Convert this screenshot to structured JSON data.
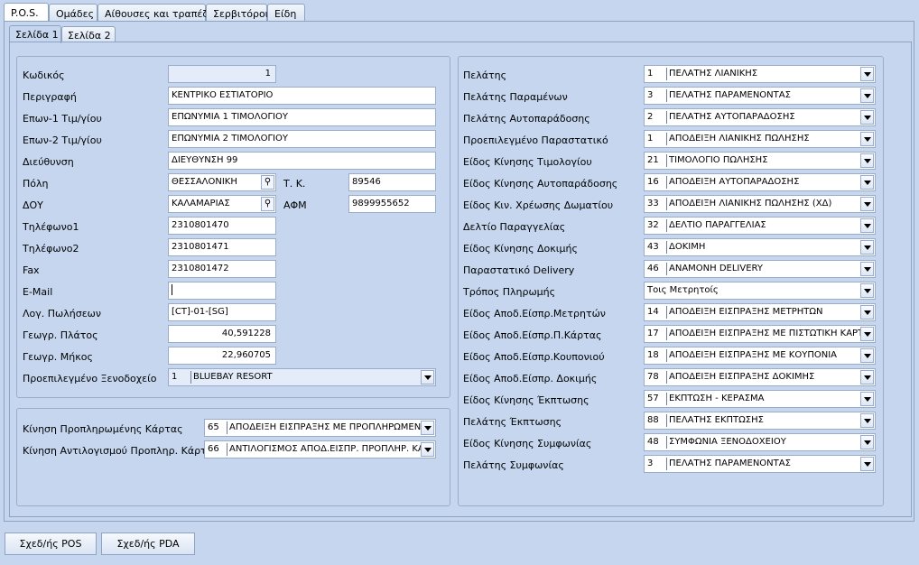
{
  "tabs": [
    "P.O.S.",
    "Ομάδες",
    "Αίθουσες και τραπέζια",
    "Σερβιτόροι",
    "Είδη"
  ],
  "subtabs": [
    "Σελίδα 1",
    "Σελίδα 2"
  ],
  "left": {
    "kodikos": {
      "label": "Κωδικός",
      "value": "1"
    },
    "perigrafi": {
      "label": "Περιγραφή",
      "value": "ΚΕΝΤΡΙΚΟ ΕΣΤΙΑΤΟΡΙΟ"
    },
    "eponymia1": {
      "label": "Επων-1 Τιμ/γίου",
      "value": "ΕΠΩΝΥΜΙΑ 1 ΤΙΜΟΛΟΓΙΟΥ"
    },
    "eponymia2": {
      "label": "Επων-2 Τιμ/γίου",
      "value": "ΕΠΩΝΥΜΙΑ 2 ΤΙΜΟΛΟΓΙΟΥ"
    },
    "dieythynsi": {
      "label": "Διεύθυνση",
      "value": "ΔΙΕΥΘΥΝΣΗ 99"
    },
    "poli": {
      "label": "Πόλη",
      "value": "ΘΕΣΣΑΛΟΝΙΚΗ"
    },
    "tk": {
      "label": "Τ. Κ.",
      "value": "89546"
    },
    "doy": {
      "label": "ΔΟΥ",
      "value": "ΚΑΛΑΜΑΡΙΑΣ"
    },
    "afm": {
      "label": "ΑΦΜ",
      "value": "9899955652"
    },
    "tel1": {
      "label": "Τηλέφωνο1",
      "value": "2310801470"
    },
    "tel2": {
      "label": "Τηλέφωνο2",
      "value": "2310801471"
    },
    "fax": {
      "label": "Fax",
      "value": "2310801472"
    },
    "email": {
      "label": "E-Mail",
      "value": ""
    },
    "log_poliseon": {
      "label": "Λογ. Πωλήσεων",
      "value": "[CT]-01-[SG]"
    },
    "platos": {
      "label": "Γεωγρ. Πλάτος",
      "value": "40,591228"
    },
    "mikos": {
      "label": "Γεωγρ. Μήκος",
      "value": "22,960705"
    },
    "xenodoxeio": {
      "label": "Προεπιλεγμένο Ξενοδοχείο",
      "code": "1",
      "text": "BLUEBAY RESORT"
    }
  },
  "bottom_left": {
    "kinisi_prepaid": {
      "label": "Κίνηση Προπληρωμένης Κάρτας",
      "code": "65",
      "text": "ΑΠΟΔΕΙΞΗ ΕΙΣΠΡΑΞΗΣ ΜΕ ΠΡΟΠΛΗΡΩΜΕΝΗ"
    },
    "kinisi_antilog": {
      "label": "Κίνηση Αντιλογισμού Προπληρ. Κάρτας",
      "code": "66",
      "text": "ΑΝΤΙΛΟΓΙΣΜΟΣ ΑΠΟΔ.ΕΙΣΠΡ. ΠΡΟΠΛΗΡ. ΚΑ"
    }
  },
  "right": [
    {
      "label": "Πελάτης",
      "code": "1",
      "text": "ΠΕΛΑΤΗΣ ΛΙΑΝΙΚΗΣ"
    },
    {
      "label": "Πελάτης Παραμένων",
      "code": "3",
      "text": "ΠΕΛΑΤΗΣ ΠΑΡΑΜΕΝΟΝΤΑΣ"
    },
    {
      "label": "Πελάτης Αυτοπαράδοσης",
      "code": "2",
      "text": "ΠΕΛΑΤΗΣ ΑΥΤΟΠΑΡΑΔΟΣΗΣ"
    },
    {
      "label": "Προεπιλεγμένο Παραστατικό",
      "code": "1",
      "text": "ΑΠΟΔΕΙΞΗ ΛΙΑΝΙΚΗΣ ΠΩΛΗΣΗΣ"
    },
    {
      "label": "Είδος Κίνησης Τιμολογίου",
      "code": "21",
      "text": "ΤΙΜΟΛΟΓΙΟ ΠΩΛΗΣΗΣ"
    },
    {
      "label": "Είδος Κίνησης Αυτοπαράδοσης",
      "code": "16",
      "text": "ΑΠΟΔΕΙΞΗ ΑΥΤΟΠΑΡΑΔΟΣΗΣ"
    },
    {
      "label": "Είδος Κιν. Χρέωσης Δωματίου",
      "code": "33",
      "text": "ΑΠΟΔΕΙΞΗ ΛΙΑΝΙΚΗΣ ΠΩΛΗΣΗΣ (ΧΔ)"
    },
    {
      "label": "Δελτίο Παραγγελίας",
      "code": "32",
      "text": "ΔΕΛΤΙΟ ΠΑΡΑΓΓΕΛΙΑΣ"
    },
    {
      "label": "Είδος Κίνησης Δοκιμής",
      "code": "43",
      "text": "ΔΟΚΙΜΗ"
    },
    {
      "label": "Παραστατικό Delivery",
      "code": "46",
      "text": "ΑΝΑΜΟΝΗ DELIVERY"
    },
    {
      "label": "Τρόπος Πληρωμής",
      "code": "",
      "text": "Τοις Μετρητοίς"
    },
    {
      "label": "Είδος Αποδ.Είσπρ.Μετρητών",
      "code": "14",
      "text": "ΑΠΟΔΕΙΞΗ ΕΙΣΠΡΑΞΗΣ ΜΕΤΡΗΤΩΝ"
    },
    {
      "label": "Είδος Αποδ.Είσπρ.Π.Κάρτας",
      "code": "17",
      "text": "ΑΠΟΔΕΙΞΗ ΕΙΣΠΡΑΞΗΣ ΜΕ ΠΙΣΤΩΤΙΚΗ ΚΑΡΤ"
    },
    {
      "label": "Είδος Αποδ.Είσπρ.Κουπονιού",
      "code": "18",
      "text": "ΑΠΟΔΕΙΞΗ ΕΙΣΠΡΑΞΗΣ ΜΕ ΚΟΥΠΟΝΙΑ"
    },
    {
      "label": "Είδος Αποδ.Είσπρ. Δοκιμής",
      "code": "78",
      "text": "ΑΠΟΔΕΙΞΗ ΕΙΣΠΡΑΞΗΣ ΔΟΚΙΜΗΣ"
    },
    {
      "label": "Είδος Κίνησης Έκπτωσης",
      "code": "57",
      "text": "ΕΚΠΤΩΣΗ - ΚΕΡΑΣΜΑ"
    },
    {
      "label": "Πελάτης Έκπτωσης",
      "code": "88",
      "text": "ΠΕΛΑΤΗΣ ΕΚΠΤΩΣΗΣ"
    },
    {
      "label": "Είδος Κίνησης Συμφωνίας",
      "code": "48",
      "text": "ΣΥΜΦΩΝΙΑ ΞΕΝΟΔΟΧΕΙΟΥ"
    },
    {
      "label": "Πελάτης Συμφωνίας",
      "code": "3",
      "text": "ΠΕΛΑΤΗΣ ΠΑΡΑΜΕΝΟΝΤΑΣ"
    }
  ],
  "buttons": {
    "pos": "Σχεδ/ής POS",
    "pda": "Σχεδ/ής PDA"
  },
  "icons": {
    "lookup": "lightbulb-icon",
    "dropdown": "chevron-down-icon"
  }
}
